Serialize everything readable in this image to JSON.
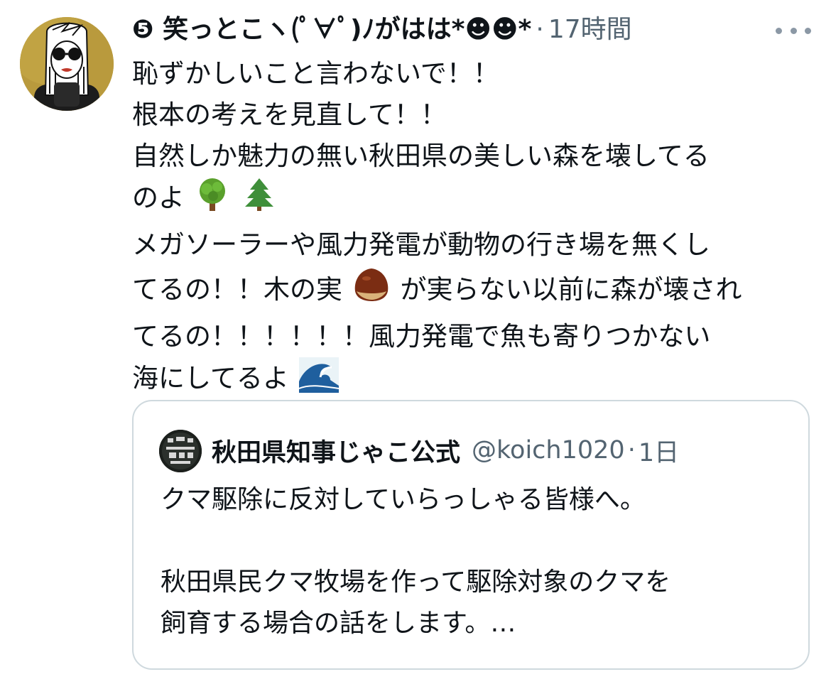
{
  "tweet": {
    "display_name": "❺ 笑っとこヽ(ﾟ∀ﾟ)ﾉがはは*☻☻*",
    "separator": "·",
    "time": "17時間",
    "body_lines": [
      "恥ずかしいこと言わないで！！",
      "根本の考えを見直して！！",
      "自然しか魅力の無い秋田県の美しい森を壊してる",
      "のよ",
      "メガソーラーや風力発電が動物の行き場を無くし",
      "てるの！！木の実",
      "が実らない以前に森が壊され",
      "てるの！！！！！！風力発電で魚も寄りつかない",
      "海にしてるよ"
    ],
    "emojis": [
      "deciduous-tree",
      "evergreen-tree",
      "chestnut",
      "water-wave"
    ]
  },
  "quote": {
    "name": "秋田県知事じゃこ公式",
    "handle": "@koich1020",
    "separator": "·",
    "time": "1日",
    "body_lines": [
      "クマ駆除に反対していらっしゃる皆様へ。",
      "",
      "秋田県民クマ牧場を作って駆除対象のクマを",
      "飼育する場合の話をします。…"
    ]
  },
  "colors": {
    "text": "#0f1419",
    "secondary": "#536471",
    "border": "#cfd9de"
  }
}
